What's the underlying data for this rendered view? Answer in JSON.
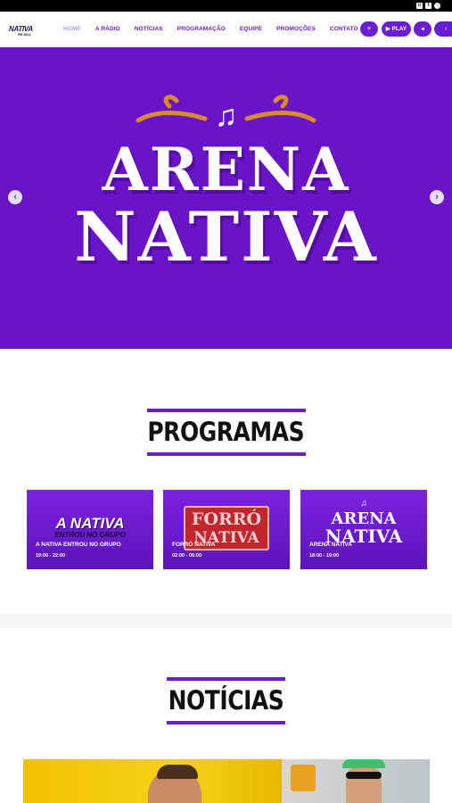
{
  "social": {
    "icons": [
      "instagram-icon",
      "facebook-icon",
      "whatsapp-icon"
    ]
  },
  "logo": {
    "name": "NATIVA",
    "sub": "FM 103,1"
  },
  "menu": [
    {
      "label": "HOME",
      "active": true
    },
    {
      "label": "A RÁDIO"
    },
    {
      "label": "NOTÍCIAS"
    },
    {
      "label": "PROGRAMAÇÃO"
    },
    {
      "label": "EQUIPE"
    },
    {
      "label": "PROMOÇÕES"
    },
    {
      "label": "CONTATO"
    }
  ],
  "controls": {
    "menu_icon": "≡",
    "play_label": "▶ PLAY",
    "volume_icon": "◂",
    "music_icon": "♪"
  },
  "hero": {
    "line1": "ARENA",
    "line2": "NATIVA",
    "note": "♫"
  },
  "programs_section": {
    "title": "PROGRAMAS"
  },
  "programs": [
    {
      "art": "A NATIVA",
      "art_sub": "ENTROU NO GRUPO",
      "name": "A NATIVA ENTROU NO GRUPO",
      "time": "19:00 - 22:00"
    },
    {
      "art": "FORRÓ",
      "art_sub": "NATIVA",
      "name": "FORRÓ NATIVA",
      "time": "02:00 - 06:00"
    },
    {
      "art": "ARENA",
      "art_sub": "NATIVA",
      "name": "ARENA NATIVA",
      "time": "18:00 - 19:00"
    }
  ],
  "news_section": {
    "title": "NOTÍCIAS"
  },
  "colors": {
    "brand": "#6a1ed4",
    "hero_bg": "#6815c9",
    "ornament": "#d98a2b"
  }
}
